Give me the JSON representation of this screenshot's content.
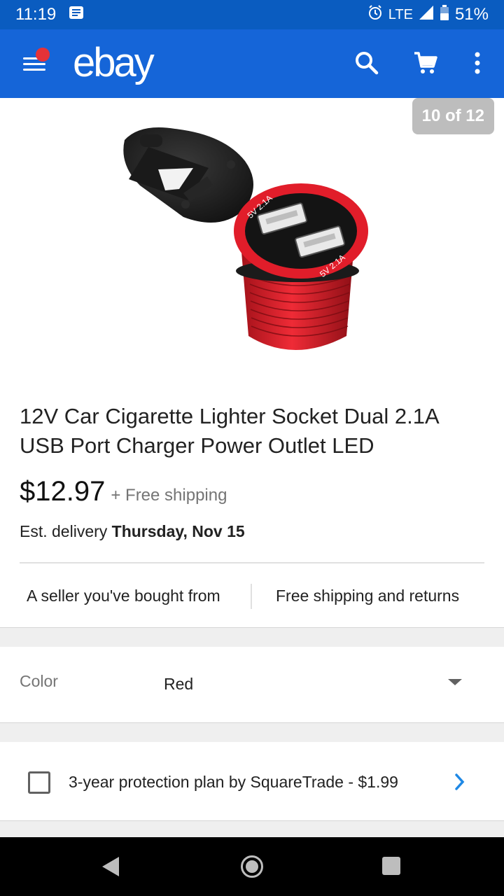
{
  "status_bar": {
    "time": "11:19",
    "network": "LTE",
    "battery": "51%",
    "icons": [
      "notification-icon",
      "alarm-icon",
      "signal-icon",
      "battery-icon"
    ]
  },
  "app_bar": {
    "logo": "ebay",
    "icons": [
      "menu-icon",
      "search-icon",
      "cart-icon",
      "more-vert-icon"
    ],
    "colors": {
      "bar": "#1565d8",
      "status": "#0a5cc0",
      "menu_badge": "#e53238"
    }
  },
  "gallery": {
    "counter": "10 of 12",
    "product_text": {
      "spec_top": "5V 2.1A",
      "spec_bottom": "5V 2.1A"
    }
  },
  "listing": {
    "title": "12V Car Cigarette Lighter Socket Dual 2.1A USB Port Charger Power Outlet LED",
    "price": "$12.97",
    "shipping": "+ Free shipping",
    "delivery_prefix": "Est. delivery",
    "delivery_date": "Thursday, Nov 15",
    "badge_left": "A seller you've bought from",
    "badge_right": "Free shipping and returns"
  },
  "options": {
    "color_label": "Color",
    "color_value": "Red"
  },
  "protection": {
    "label": "3-year protection plan by SquareTrade - $1.99",
    "checked": false
  },
  "nav_bar": {
    "icons": [
      "back-icon",
      "home-icon",
      "recent-apps-icon"
    ]
  }
}
